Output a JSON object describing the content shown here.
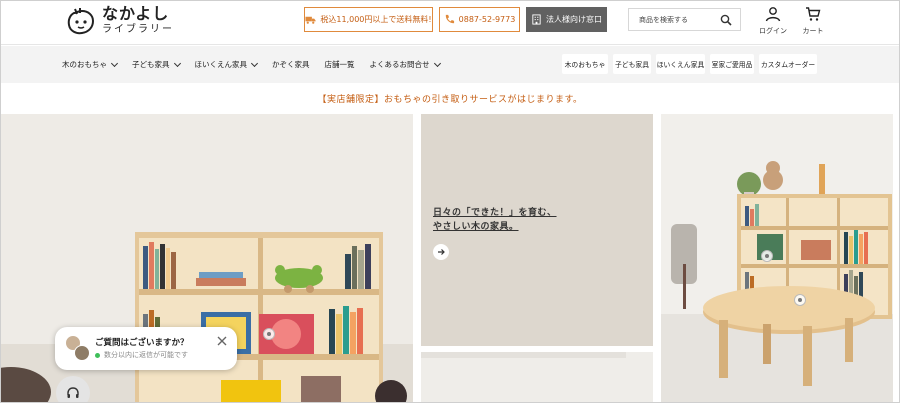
{
  "brand": {
    "logo_main": "なかよし",
    "logo_sub": "ライブラリー"
  },
  "header": {
    "shipping_label": "税込11,000円以上で送料無料!",
    "phone_label": "0887-52-9773",
    "corporate_label": "法人様向け窓口",
    "search_placeholder": "商品を検索する",
    "login_label": "ログイン",
    "cart_label": "カート"
  },
  "nav": {
    "items": [
      {
        "label": "木のおもちゃ",
        "has_dropdown": true
      },
      {
        "label": "子ども家具",
        "has_dropdown": true
      },
      {
        "label": "ほいくえん家具",
        "has_dropdown": true
      },
      {
        "label": "かぞく家具",
        "has_dropdown": false
      },
      {
        "label": "店舗一覧",
        "has_dropdown": false
      },
      {
        "label": "よくあるお問合せ",
        "has_dropdown": true
      }
    ],
    "chips": [
      {
        "label": "木のおもちゃ"
      },
      {
        "label": "子ども家具"
      },
      {
        "label": "ほいくえん家具"
      },
      {
        "label": "室家ご愛用品"
      },
      {
        "label": "カスタムオーダー"
      }
    ]
  },
  "notice": "【実店舗限定】おもちゃの引き取りサービスがはじまります。",
  "hero": {
    "mid_line1": "日々の「できた！」を育む、",
    "mid_line2": "やさしい木の家具。"
  },
  "chat": {
    "title": "ご質問はございますか？",
    "subtitle": "数分以内に返信が可能です"
  },
  "colors": {
    "accent": "#c45d12",
    "accent_border": "#e08a3c",
    "corp_button": "#616161",
    "nav_bg": "#f3f3f3",
    "online_dot": "#3fbf5a"
  }
}
